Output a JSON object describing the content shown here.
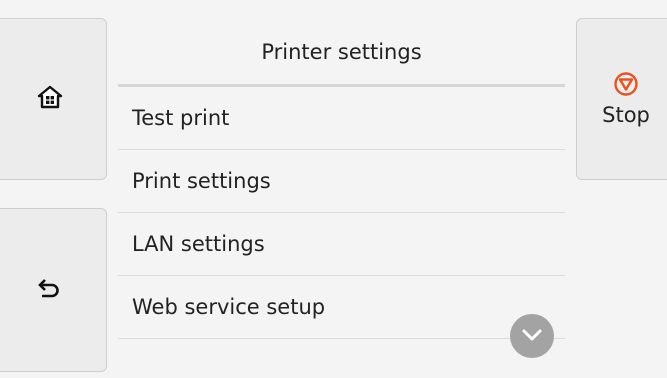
{
  "header": {
    "title": "Printer settings"
  },
  "nav": {
    "home_icon": "home-icon",
    "back_icon": "back-arrow-icon"
  },
  "stop": {
    "label": "Stop",
    "icon": "stop-icon",
    "accent": "#e8531f"
  },
  "menu": {
    "items": [
      {
        "label": "Test print"
      },
      {
        "label": "Print settings"
      },
      {
        "label": "LAN settings"
      },
      {
        "label": "Web service setup"
      }
    ]
  },
  "scroll": {
    "icon": "chevron-down-icon"
  }
}
